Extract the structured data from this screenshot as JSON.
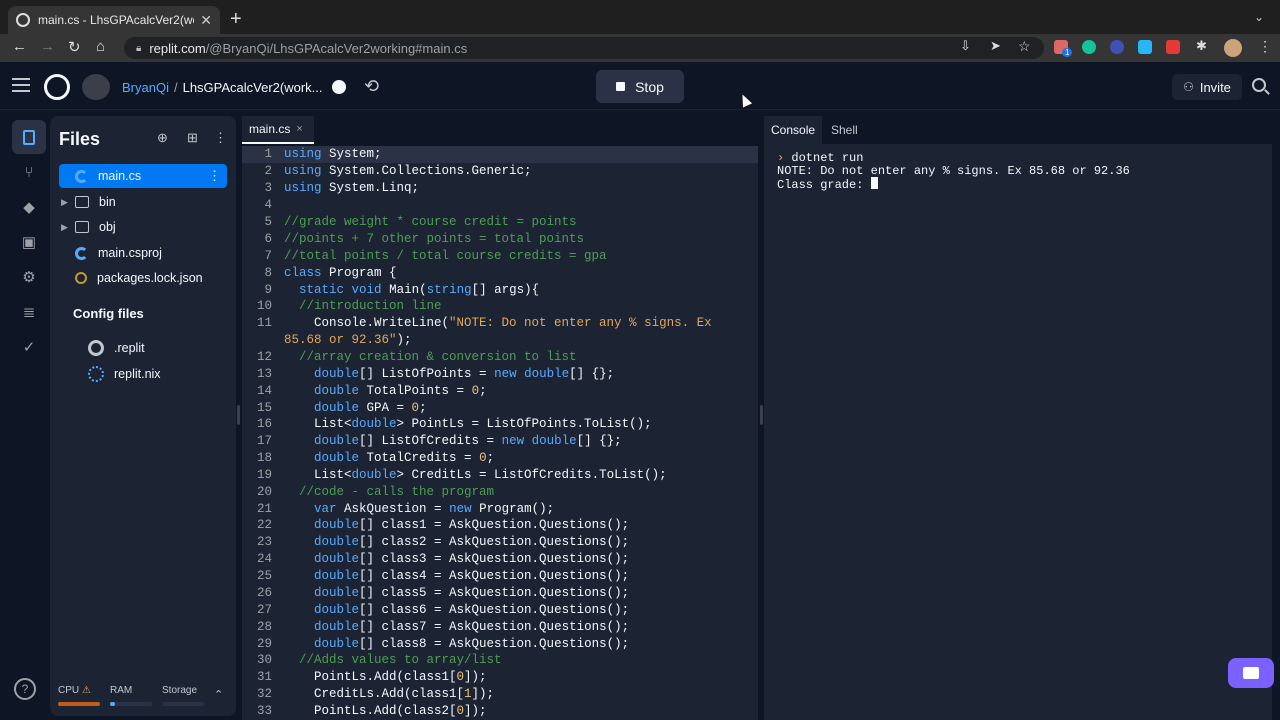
{
  "browser": {
    "tab_title": "main.cs - LhsGPAcalcVer2(wor",
    "tab_close": "✕",
    "new_tab": "+",
    "url_host": "replit.com",
    "url_path": "/@BryanQi/LhsGPAcalcVer2working#main.cs",
    "extension_badge": "1"
  },
  "header": {
    "username": "BryanQi",
    "separator": "/",
    "repl_name": "LhsGPAcalcVer2(work...",
    "stop_label": "Stop",
    "invite_label": "Invite"
  },
  "files_panel": {
    "title": "Files",
    "items": [
      {
        "name": "main.cs",
        "icon": "csharp-icon",
        "active": true
      },
      {
        "name": "bin",
        "icon": "folder-icon"
      },
      {
        "name": "obj",
        "icon": "folder-icon"
      },
      {
        "name": "main.csproj",
        "icon": "csharp-icon"
      },
      {
        "name": "packages.lock.json",
        "icon": "json-icon"
      }
    ],
    "config_title": "Config files",
    "config_items": [
      {
        "name": ".replit",
        "icon": "replit-icon"
      },
      {
        "name": "replit.nix",
        "icon": "nix-icon"
      }
    ]
  },
  "resources": {
    "cpu": "CPU",
    "ram": "RAM",
    "storage": "Storage",
    "help": "?"
  },
  "editor": {
    "tab_label": "main.cs",
    "tab_close": "×",
    "line_numbers": [
      "1",
      "2",
      "3",
      "4",
      "5",
      "6",
      "7",
      "8",
      "9",
      "10",
      "11",
      "",
      "12",
      "13",
      "14",
      "15",
      "16",
      "17",
      "18",
      "19",
      "20",
      "21",
      "22",
      "23",
      "24",
      "25",
      "26",
      "27",
      "28",
      "29",
      "30",
      "31",
      "32",
      "33"
    ]
  },
  "console": {
    "tab_console": "Console",
    "tab_shell": "Shell",
    "prompt": "›",
    "command": "dotnet run",
    "line1": "NOTE: Do not enter any % signs. Ex 85.68 or 92.36",
    "line2": "Class grade: "
  },
  "colors": {
    "background": "#0e1525",
    "panel": "#1c2333",
    "accent": "#0079f2",
    "link": "#57abff",
    "chat": "#7b61ff"
  }
}
